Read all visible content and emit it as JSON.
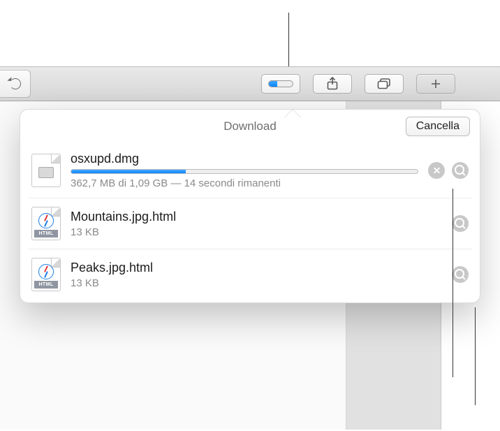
{
  "toolbar": {
    "downloads_progress_percent": 34
  },
  "popover": {
    "title": "Download",
    "clear_label": "Cancella"
  },
  "downloads": [
    {
      "name": "osxupd.dmg",
      "status": "362,7 MB di 1,09 GB — 14 secondi rimanenti",
      "progress_percent": 33,
      "type": "dmg",
      "in_progress": true
    },
    {
      "name": "Mountains.jpg.html",
      "status": "13 KB",
      "type": "html",
      "in_progress": false
    },
    {
      "name": "Peaks.jpg.html",
      "status": "13 KB",
      "type": "html",
      "in_progress": false
    }
  ],
  "icon_labels": {
    "html": "HTML"
  }
}
